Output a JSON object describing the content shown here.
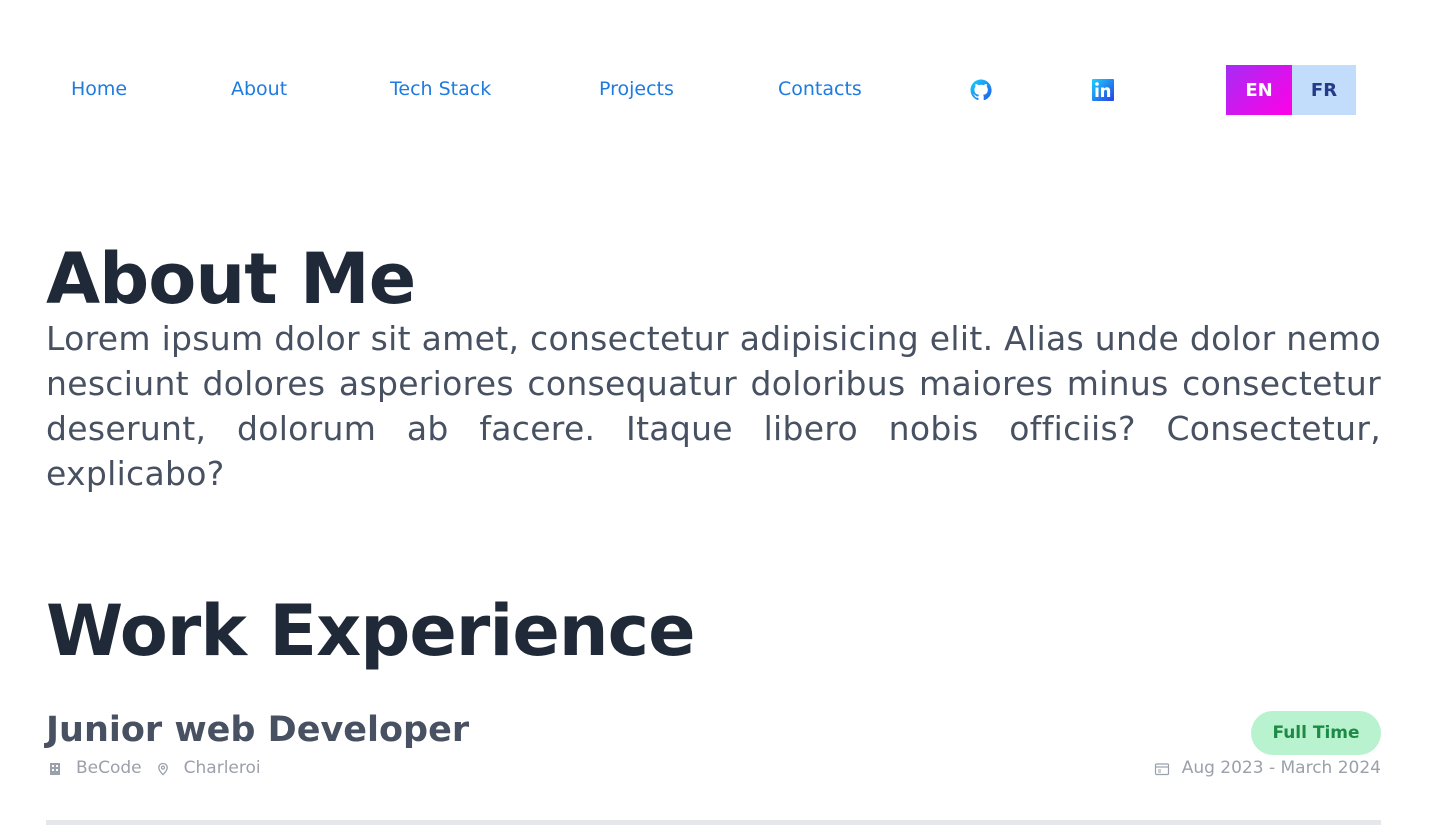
{
  "nav": {
    "links": [
      "Home",
      "About",
      "Tech Stack",
      "Projects",
      "Contacts"
    ],
    "icons": [
      "github-icon",
      "linkedin-icon"
    ]
  },
  "lang": {
    "en": "EN",
    "fr": "FR",
    "active": "EN"
  },
  "about": {
    "title": "About Me",
    "text": "Lorem ipsum dolor sit amet, consectetur adipisicing elit. Alias unde dolor nemo nesciunt dolores asperiores consequatur doloribus maiores minus consectetur deserunt, dolorum ab facere. Itaque libero nobis officiis? Consectetur, explicabo?"
  },
  "work": {
    "title": "Work Experience",
    "jobs": [
      {
        "title": "Junior web Developer",
        "company": "BeCode",
        "location": "Charleroi",
        "type": "Full Time",
        "dates": "Aug 2023 - March 2024"
      }
    ]
  },
  "colors": {
    "link": "#1e7be0",
    "heading": "#1f2937",
    "body": "#475161",
    "muted": "#9aa1ab",
    "badge_bg": "#b9f2cf",
    "badge_text": "#1d8b45"
  }
}
